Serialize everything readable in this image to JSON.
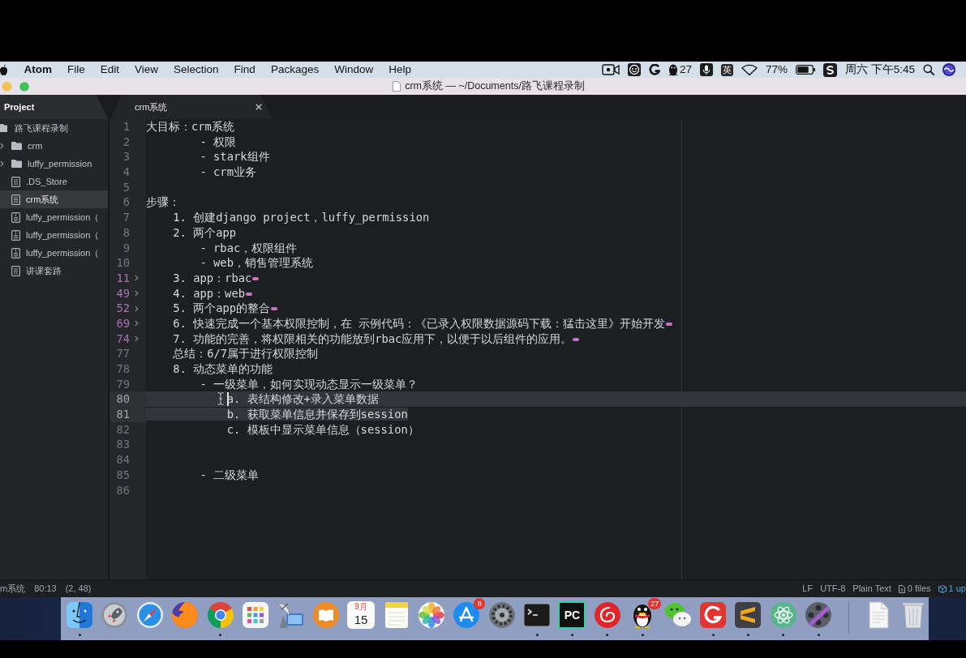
{
  "menu_bar": {
    "app_name": "Atom",
    "menus": [
      "File",
      "Edit",
      "View",
      "Selection",
      "Find",
      "Packages",
      "Window",
      "Help"
    ],
    "qq_count": "27",
    "input_method": "英",
    "battery": "77%",
    "clock": "周六 下午5:45"
  },
  "window": {
    "title": "crm系统 — ~/Documents/路飞课程录制"
  },
  "project_panel": {
    "title": "Project",
    "tree": [
      {
        "label": "路飞课程录制",
        "kind": "folder",
        "selected": false,
        "children": [
          {
            "label": "crm",
            "kind": "folder",
            "expanded": false,
            "selected": false
          },
          {
            "label": "luffy_permission",
            "kind": "folder",
            "expanded": false,
            "selected": false
          },
          {
            "label": ".DS_Store",
            "kind": "text",
            "selected": false
          },
          {
            "label": "crm系统",
            "kind": "text",
            "selected": true
          },
          {
            "label": "luffy_permission（",
            "kind": "zip",
            "selected": false
          },
          {
            "label": "luffy_permission（",
            "kind": "zip",
            "selected": false
          },
          {
            "label": "luffy_permission（",
            "kind": "zip",
            "selected": false
          },
          {
            "label": "讲课套路",
            "kind": "text",
            "selected": false
          }
        ]
      }
    ]
  },
  "editor": {
    "tab": "crm系统",
    "lines": [
      {
        "number": "1",
        "text": "大目标：crm系统",
        "folded": false,
        "selected": false,
        "cursor": false
      },
      {
        "number": "2",
        "text": "        - 权限",
        "folded": false,
        "selected": false,
        "cursor": false
      },
      {
        "number": "3",
        "text": "        - stark组件",
        "folded": false,
        "selected": false,
        "cursor": false
      },
      {
        "number": "4",
        "text": "        - crm业务",
        "folded": false,
        "selected": false,
        "cursor": false
      },
      {
        "number": "5",
        "folded": false,
        "selected": false,
        "cursor": false
      },
      {
        "number": "6",
        "text": "步骤：",
        "folded": false,
        "selected": false,
        "cursor": false
      },
      {
        "number": "7",
        "text": "    1. 创建django project，luffy_permission",
        "folded": false,
        "selected": false,
        "cursor": false
      },
      {
        "number": "8",
        "text": "    2. 两个app",
        "folded": false,
        "selected": false,
        "cursor": false
      },
      {
        "number": "9",
        "text": "        - rbac，权限组件",
        "folded": false,
        "selected": false,
        "cursor": false
      },
      {
        "number": "10",
        "text": "        - web，销售管理系统",
        "folded": false,
        "selected": false,
        "cursor": false
      },
      {
        "number": "11",
        "text": "    3. app：rbac",
        "folded": true,
        "selected": false,
        "cursor": false
      },
      {
        "number": "49",
        "text": "    4. app：web",
        "folded": true,
        "selected": false,
        "cursor": false
      },
      {
        "number": "52",
        "text": "    5. 两个app的整合",
        "folded": true,
        "selected": false,
        "cursor": false
      },
      {
        "number": "69",
        "text": "    6. 快速完成一个基本权限控制，在 示例代码：《已录入权限数据源码下载：猛击这里》开始开发",
        "folded": true,
        "selected": false,
        "cursor": false
      },
      {
        "number": "74",
        "text": "    7. 功能的完善，将权限相关的功能放到rbac应用下，以便于以后组件的应用。",
        "folded": true,
        "selected": false,
        "cursor": false
      },
      {
        "number": "77",
        "text": "    总结：6/7属于进行权限控制",
        "folded": false,
        "selected": false,
        "cursor": false
      },
      {
        "number": "78",
        "text": "    8. 动态菜单的功能",
        "folded": false,
        "selected": false,
        "cursor": false
      },
      {
        "number": "79",
        "text": "        - 一级菜单，如何实现动态显示一级菜单？",
        "folded": false,
        "selected": false,
        "cursor": false
      },
      {
        "number": "80",
        "text": "            a. 表结构修改+录入菜单数据",
        "folded": false,
        "selected": true,
        "cursor": true
      },
      {
        "number": "81",
        "text": "            b. 获取菜单信息并保存到session",
        "folded": false,
        "selected": true,
        "cursor": false
      },
      {
        "number": "82",
        "text": "            c. 模板中显示菜单信息（session）",
        "folded": false,
        "selected": false,
        "cursor": false
      },
      {
        "number": "83",
        "folded": false,
        "selected": false,
        "cursor": false
      },
      {
        "number": "84",
        "folded": false,
        "selected": false,
        "cursor": false
      },
      {
        "number": "85",
        "text": "        - 二级菜单",
        "folded": false,
        "selected": false,
        "cursor": false
      },
      {
        "number": "86",
        "folded": false,
        "selected": false,
        "cursor": false
      }
    ]
  },
  "status_bar": {
    "file": "m系统",
    "cursor": "80:13",
    "selection": "(2, 48)",
    "line_ending": "LF",
    "encoding": "UTF-8",
    "grammar": "Plain Text",
    "git_files": "0 files",
    "updates": "1 up"
  },
  "dock": {
    "apps": [
      {
        "kind": "face",
        "running": true
      },
      {
        "kind": "rocket",
        "running": false
      },
      {
        "kind": "compass",
        "running": false
      },
      {
        "kind": "fox",
        "running": false
      },
      {
        "kind": "tricolor",
        "running": true
      },
      {
        "kind": "grid",
        "running": false
      },
      {
        "kind": "dish",
        "running": false
      },
      {
        "kind": "book",
        "running": false
      },
      {
        "kind": "calendar",
        "month": "9月",
        "day": "15",
        "running": false
      },
      {
        "kind": "notepad",
        "running": false
      },
      {
        "kind": "flower",
        "running": false
      },
      {
        "kind": "store",
        "badge": "8",
        "running": false
      },
      {
        "kind": "gear",
        "running": false
      },
      {
        "kind": "terminal",
        "running": true
      },
      {
        "kind": "ide",
        "label": "PC",
        "running": true
      },
      {
        "kind": "music",
        "running": true
      },
      {
        "kind": "penguin",
        "badge": "27",
        "running": true
      },
      {
        "kind": "chat",
        "running": false
      },
      {
        "kind": "swirl",
        "running": true
      },
      {
        "kind": "stripes",
        "running": true
      },
      {
        "kind": "atom",
        "running": true
      },
      {
        "kind": "film",
        "running": true
      }
    ],
    "stack": [
      {
        "kind": "document",
        "running": false
      },
      {
        "kind": "trash",
        "running": false
      }
    ]
  }
}
